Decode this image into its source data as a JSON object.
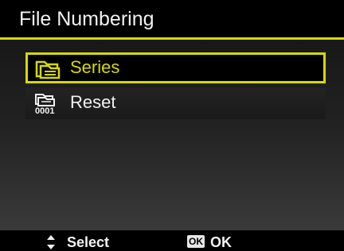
{
  "header": {
    "title": "File Numbering"
  },
  "menu": {
    "items": [
      {
        "label": "Series",
        "icon": "series-folder-icon",
        "selected": true
      },
      {
        "label": "Reset",
        "icon": "reset-counter-icon",
        "selected": false
      }
    ]
  },
  "footer": {
    "select_label": "Select",
    "ok_badge": "OK",
    "ok_label": "OK"
  },
  "colors": {
    "accent": "#d6d900",
    "background": "#000000",
    "text": "#f2f2f2"
  }
}
